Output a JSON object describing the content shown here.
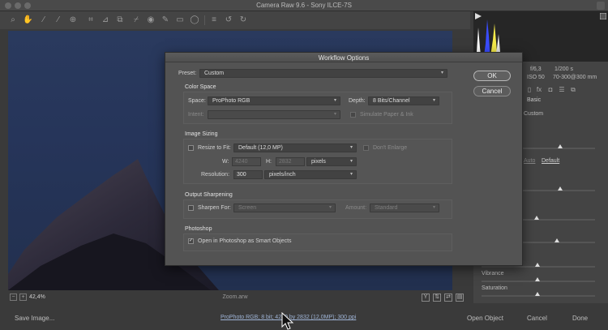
{
  "window": {
    "title": "Camera Raw 9.6  -  Sony ILCE-7S"
  },
  "toolbar": {
    "tools": [
      "zoom-icon",
      "hand-icon",
      "white-balance-icon",
      "color-sampler-icon",
      "target-adjust-icon",
      "crop-icon",
      "straighten-icon",
      "transform-icon",
      "spot-removal-icon",
      "red-eye-icon",
      "adjustment-brush-icon",
      "graduated-filter-icon",
      "radial-filter-icon",
      "preferences-icon",
      "rotate-left-icon",
      "rotate-right-icon"
    ]
  },
  "camera_info": {
    "aperture": "f/6,3",
    "shutter": "1/200 s",
    "iso": "ISO 50",
    "lens": "70-300@300 mm"
  },
  "panel": {
    "basic_title": "Basic",
    "wb_value": "Custom",
    "auto": "Auto",
    "default": "Default",
    "vibrance": "Vibrance",
    "saturation": "Saturation"
  },
  "status": {
    "zoom": "42,4%",
    "file_name": "Zoom.arw"
  },
  "footer": {
    "save_image": "Save Image...",
    "workflow_link": "ProPhoto RGB; 8 bit; 4240 by 2832 (12,0MP); 300 ppi",
    "open_object": "Open Object",
    "cancel": "Cancel",
    "done": "Done"
  },
  "dialog": {
    "title": "Workflow Options",
    "preset_label": "Preset:",
    "preset_value": "Custom",
    "ok": "OK",
    "cancel": "Cancel",
    "color_space": {
      "title": "Color Space",
      "space_label": "Space:",
      "space_value": "ProPhoto RGB",
      "depth_label": "Depth:",
      "depth_value": "8 Bits/Channel",
      "intent_label": "Intent:",
      "simulate": "Simulate Paper & Ink"
    },
    "image_sizing": {
      "title": "Image Sizing",
      "resize_label": "Resize to Fit:",
      "resize_value": "Default  (12,0 MP)",
      "dont_enlarge": "Don't Enlarge",
      "w_label": "W:",
      "w_value": "4240",
      "h_label": "H:",
      "h_value": "2832",
      "unit_value": "pixels",
      "resolution_label": "Resolution:",
      "resolution_value": "300",
      "resolution_unit": "pixels/inch"
    },
    "output_sharpening": {
      "title": "Output Sharpening",
      "sharpen_label": "Sharpen For:",
      "sharpen_value": "Screen",
      "amount_label": "Amount:",
      "amount_value": "Standard"
    },
    "photoshop": {
      "title": "Photoshop",
      "smart_objects": "Open in Photoshop as Smart Objects",
      "smart_objects_checked": true
    }
  }
}
